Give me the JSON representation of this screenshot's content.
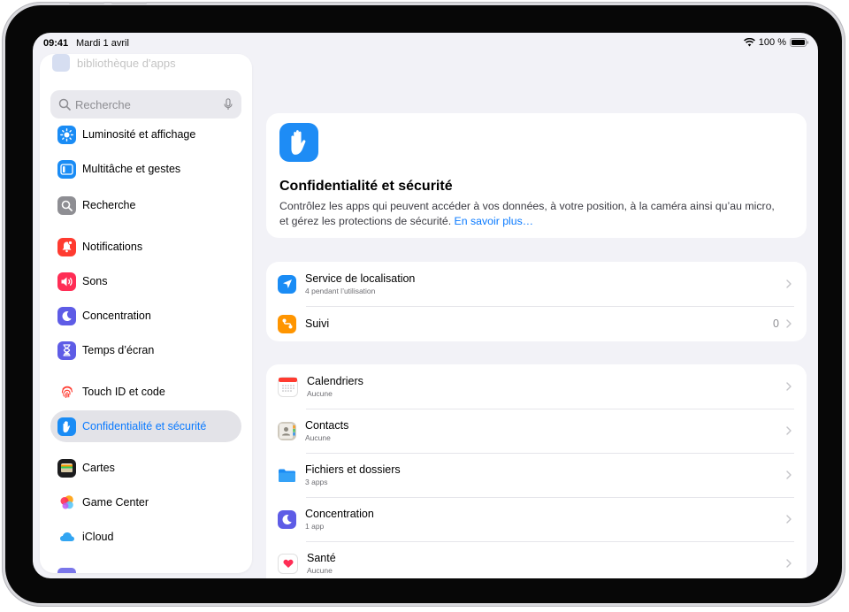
{
  "status": {
    "time": "09:41",
    "date": "Mardi 1 avril",
    "battery": "100 %"
  },
  "sidebar": {
    "faded_item": "bibliothèque d'apps",
    "search_placeholder": "Recherche",
    "items": [
      {
        "label": "Luminosité et affichage",
        "color": "#1a8cf5",
        "icon": "sun-icon"
      },
      {
        "label": "Multitâche et gestes",
        "color": "#1a8cf5",
        "icon": "multitask-icon"
      },
      {
        "label": "Recherche",
        "color": "#8e8e93",
        "icon": "search-icon"
      },
      {
        "label": "Notifications",
        "color": "#ff3b30",
        "icon": "bell-icon"
      },
      {
        "label": "Sons",
        "color": "#ff2d55",
        "icon": "speaker-icon"
      },
      {
        "label": "Concentration",
        "color": "#5e5ce6",
        "icon": "moon-icon"
      },
      {
        "label": "Temps d’écran",
        "color": "#5e5ce6",
        "icon": "hourglass-icon"
      },
      {
        "label": "Touch ID et code",
        "color": "#ffffff",
        "icon": "fingerprint-icon"
      },
      {
        "label": "Confidentialité et sécurité",
        "color": "#1a8cf5",
        "icon": "hand-icon",
        "selected": true
      },
      {
        "label": "Cartes",
        "color": "#1c1c1e",
        "icon": "wallet-icon"
      },
      {
        "label": "Game Center",
        "color": "#ffffff",
        "icon": "game-center-icon"
      },
      {
        "label": "iCloud",
        "color": "#ffffff",
        "icon": "cloud-icon"
      }
    ]
  },
  "hero": {
    "title": "Confidentialité et sécurité",
    "description": "Contrôlez les apps qui peuvent accéder à vos données, à votre position, à la caméra ainsi qu’au micro, et gérez les protections de sécurité.",
    "link": "En savoir plus…"
  },
  "group1": [
    {
      "title": "Service de localisation",
      "subtitle": "4 pendant l’utilisation",
      "value": "",
      "icon": "location-arrow-icon",
      "color": "#1a8cf5"
    },
    {
      "title": "Suivi",
      "subtitle": "",
      "value": "0",
      "icon": "tracking-icon",
      "color": "#ff9500"
    }
  ],
  "group2": [
    {
      "title": "Calendriers",
      "subtitle": "Aucune",
      "icon": "calendar-icon"
    },
    {
      "title": "Contacts",
      "subtitle": "Aucune",
      "icon": "contacts-icon"
    },
    {
      "title": "Fichiers et dossiers",
      "subtitle": "3 apps",
      "icon": "folder-icon"
    },
    {
      "title": "Concentration",
      "subtitle": "1 app",
      "icon": "moon-icon"
    },
    {
      "title": "Santé",
      "subtitle": "Aucune",
      "icon": "health-heart-icon"
    }
  ]
}
